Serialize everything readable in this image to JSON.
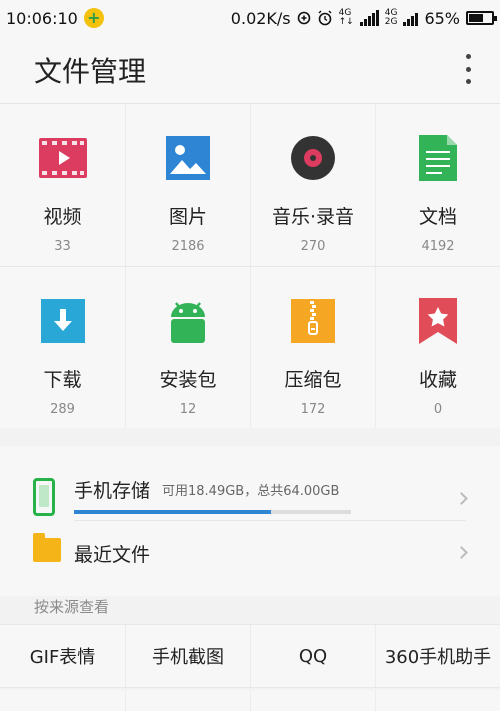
{
  "status_bar": {
    "time": "10:06:10",
    "net_speed": "0.02K/s",
    "network_top": "4G",
    "network_bottom": "4G",
    "network_bottom2": "2G",
    "battery": "65%"
  },
  "header": {
    "title": "文件管理"
  },
  "categories": [
    {
      "label": "视频",
      "count": "33",
      "icon": "video-icon",
      "color": "#dc3c5f"
    },
    {
      "label": "图片",
      "count": "2186",
      "icon": "image-icon",
      "color": "#2d85d4"
    },
    {
      "label": "音乐·录音",
      "count": "270",
      "icon": "music-disc-icon",
      "color": "#333333"
    },
    {
      "label": "文档",
      "count": "4192",
      "icon": "document-icon",
      "color": "#33b357"
    },
    {
      "label": "下载",
      "count": "289",
      "icon": "download-icon",
      "color": "#29a8d8"
    },
    {
      "label": "安装包",
      "count": "12",
      "icon": "android-icon",
      "color": "#33b357"
    },
    {
      "label": "压缩包",
      "count": "172",
      "icon": "zip-icon",
      "color": "#f5a623"
    },
    {
      "label": "收藏",
      "count": "0",
      "icon": "bookmark-star-icon",
      "color": "#e04c57"
    }
  ],
  "storage": {
    "title": "手机存储",
    "meta": "可用18.49GB，总共64.00GB",
    "used_fraction": 0.711
  },
  "recent": {
    "label": "最近文件"
  },
  "sources_section": {
    "label": "按来源查看"
  },
  "sources": [
    "GIF表情",
    "手机截图",
    "QQ",
    "360手机助手"
  ]
}
